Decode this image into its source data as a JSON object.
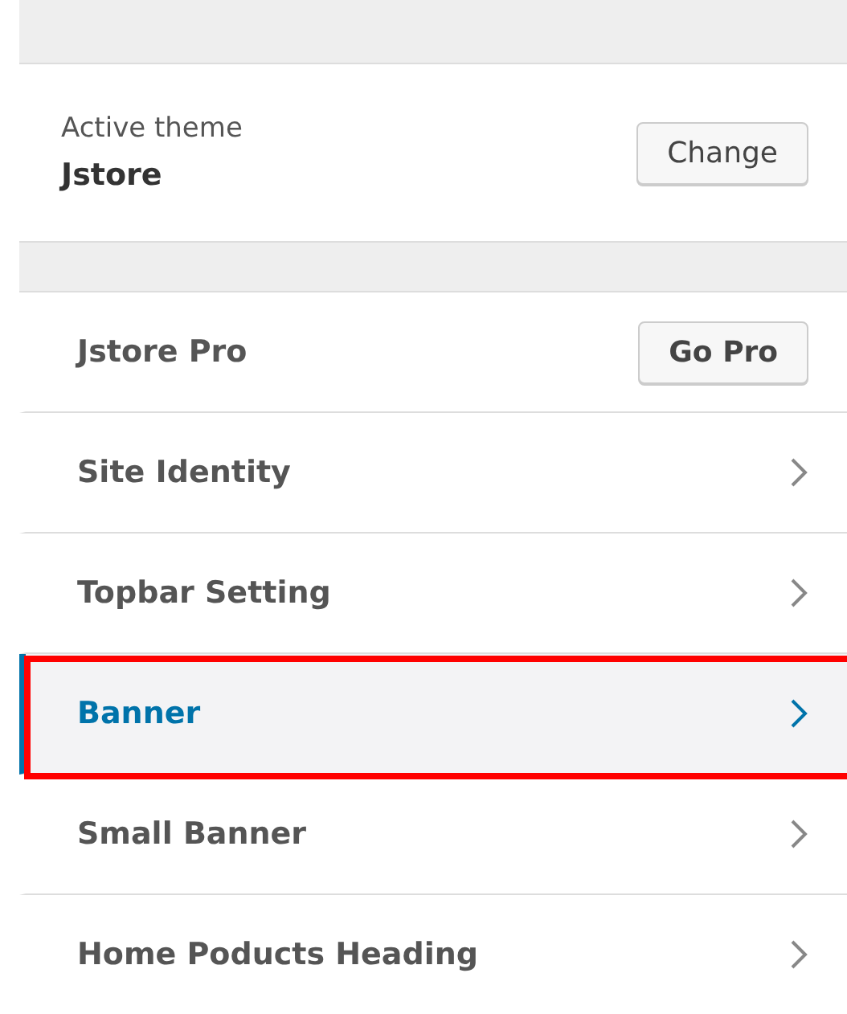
{
  "active_theme": {
    "label": "Active theme",
    "name": "Jstore",
    "button": "Change"
  },
  "pro": {
    "label": "Jstore Pro",
    "button": "Go Pro"
  },
  "sections": [
    {
      "label": "Site Identity",
      "selected": false,
      "annotated": false
    },
    {
      "label": "Topbar Setting",
      "selected": false,
      "annotated": false
    },
    {
      "label": "Banner",
      "selected": true,
      "annotated": true
    },
    {
      "label": "Small Banner",
      "selected": false,
      "annotated": false
    },
    {
      "label": "Home Poducts Heading",
      "selected": false,
      "annotated": false
    }
  ]
}
